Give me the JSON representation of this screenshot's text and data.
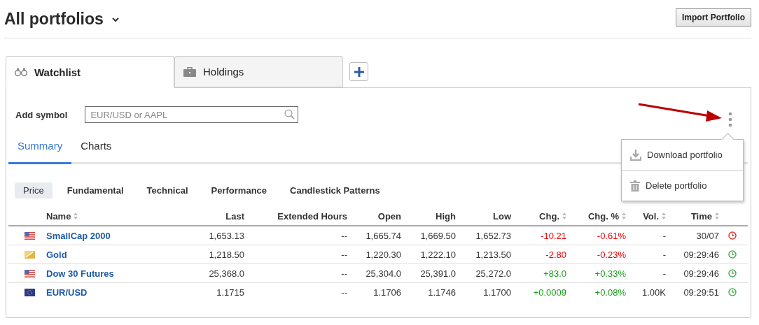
{
  "header": {
    "title": "All portfolios",
    "import_button": "Import Portfolio"
  },
  "portfolio_tabs": [
    {
      "label": "Watchlist",
      "selected": true
    },
    {
      "label": "Holdings",
      "selected": false
    }
  ],
  "add_symbol": {
    "label": "Add symbol",
    "placeholder": "EUR/USD or AAPL"
  },
  "view_tabs": [
    {
      "label": "Summary",
      "selected": true
    },
    {
      "label": "Charts",
      "selected": false
    }
  ],
  "menu": {
    "items": [
      "Download portfolio",
      "Delete portfolio"
    ]
  },
  "sub_tabs": [
    {
      "label": "Price",
      "selected": true
    },
    {
      "label": "Fundamental",
      "selected": false
    },
    {
      "label": "Technical",
      "selected": false
    },
    {
      "label": "Performance",
      "selected": false
    },
    {
      "label": "Candlestick Patterns",
      "selected": false
    }
  ],
  "table": {
    "columns": [
      {
        "label": "Name",
        "sortable": true
      },
      {
        "label": "Last",
        "sortable": false
      },
      {
        "label": "Extended Hours",
        "sortable": false
      },
      {
        "label": "Open",
        "sortable": false
      },
      {
        "label": "High",
        "sortable": false
      },
      {
        "label": "Low",
        "sortable": false
      },
      {
        "label": "Chg.",
        "sortable": true
      },
      {
        "label": "Chg. %",
        "sortable": true
      },
      {
        "label": "Vol.",
        "sortable": true
      },
      {
        "label": "Time",
        "sortable": true
      }
    ],
    "rows": [
      {
        "kind": "us",
        "name": "SmallCap 2000",
        "last": "1,653.13",
        "extended": "--",
        "open": "1,665.74",
        "high": "1,669.50",
        "low": "1,652.73",
        "chg": "-10.21",
        "chg_pct": "-0.61%",
        "color": "#ee0000",
        "vol": "-",
        "time": "30/07",
        "market_open": false
      },
      {
        "kind": "commodity",
        "name": "Gold",
        "last": "1,218.50",
        "extended": "--",
        "open": "1,220.30",
        "high": "1,222.10",
        "low": "1,213.50",
        "chg": "-2.80",
        "chg_pct": "-0.23%",
        "color": "#ee0000",
        "vol": "-",
        "time": "09:29:46",
        "market_open": true
      },
      {
        "kind": "us",
        "name": "Dow 30 Futures",
        "last": "25,368.0",
        "extended": "--",
        "open": "25,304.0",
        "high": "25,391.0",
        "low": "25,272.0",
        "chg": "+83.0",
        "chg_pct": "+0.33%",
        "color": "#1a9e1a",
        "vol": "-",
        "time": "09:29:46",
        "market_open": true
      },
      {
        "kind": "eu",
        "name": "EUR/USD",
        "last": "1.1715",
        "extended": "--",
        "open": "1.1706",
        "high": "1.1746",
        "low": "1.1700",
        "chg": "+0.0009",
        "chg_pct": "+0.08%",
        "color": "#1a9e1a",
        "vol": "1.00K",
        "time": "09:29:51",
        "market_open": true
      }
    ]
  }
}
